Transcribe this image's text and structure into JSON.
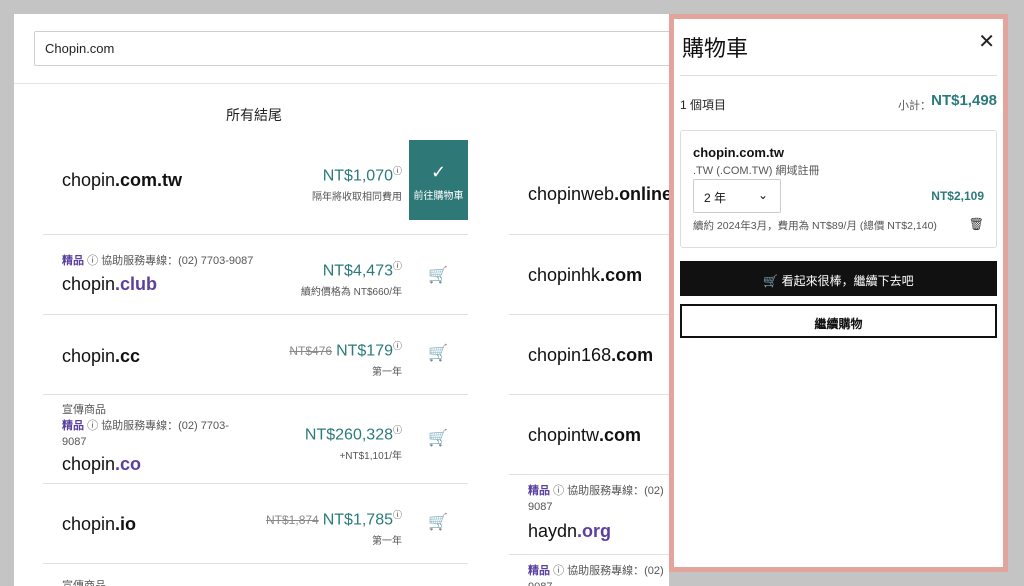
{
  "search": {
    "value": "Chopin.com"
  },
  "results": {
    "section_title": "所有結尾",
    "left": [
      {
        "name": "chopin",
        "tld": ".com.tw",
        "tld_style": "bold",
        "price": "NT$1,070",
        "note": "隔年將收取相同費用",
        "in_cart": true,
        "go_cart_label": "前往購物車"
      },
      {
        "name": "chopin",
        "tld": ".club",
        "tld_style": "purple",
        "tag": "精品",
        "support": "協助服務專線：(02) 7703-9087",
        "price": "NT$4,473",
        "note": "續約價格為 NT$660/年"
      },
      {
        "name": "chopin",
        "tld": ".cc",
        "tld_style": "bold",
        "old_price": "NT$476",
        "price": "NT$179",
        "note": "第一年"
      },
      {
        "name": "chopin",
        "tld": ".co",
        "tld_style": "purple",
        "promo": "宣傳商品",
        "tag": "精品",
        "support": "協助服務專線：(02) 7703-",
        "support_cont": "9087",
        "price": "NT$260,328",
        "note": "+NT$1,101/年"
      },
      {
        "name": "chopin",
        "tld": ".io",
        "tld_style": "bold",
        "old_price": "NT$1,874",
        "price": "NT$1,785",
        "note": "第一年"
      },
      {
        "promo": "宣傳商品"
      }
    ],
    "right": [
      {
        "name": "chopinweb",
        "tld": ".online"
      },
      {
        "name": "chopinhk",
        "tld": ".com"
      },
      {
        "name": "chopin168",
        "tld": ".com"
      },
      {
        "name": "chopintw",
        "tld": ".com"
      },
      {
        "name": "haydn",
        "tld": ".org",
        "tag": "精品",
        "support": "協助服務專線：(02)",
        "support_cont": "9087"
      },
      {
        "tag": "精品",
        "support": "協助服務專線：(02)",
        "support_cont": "9087"
      }
    ]
  },
  "cart": {
    "title": "購物車",
    "items_count": "1 個項目",
    "subtotal_label": "小計：",
    "subtotal": "NT$1,498",
    "item": {
      "domain": "chopin.com.tw",
      "desc": ".TW (.COM.TW) 網域註冊",
      "term": "2 年",
      "price": "NT$2,109",
      "renewal": "續約 2024年3月，費用為 NT$89/月 (總價 NT$2,140)"
    },
    "checkout_label": "看起來很棒，繼續下去吧",
    "continue_label": "繼續購物"
  },
  "colors": {
    "accent": "#2c7a7b",
    "premium": "#5b3fa0",
    "panel_border": "#e3a59b"
  }
}
